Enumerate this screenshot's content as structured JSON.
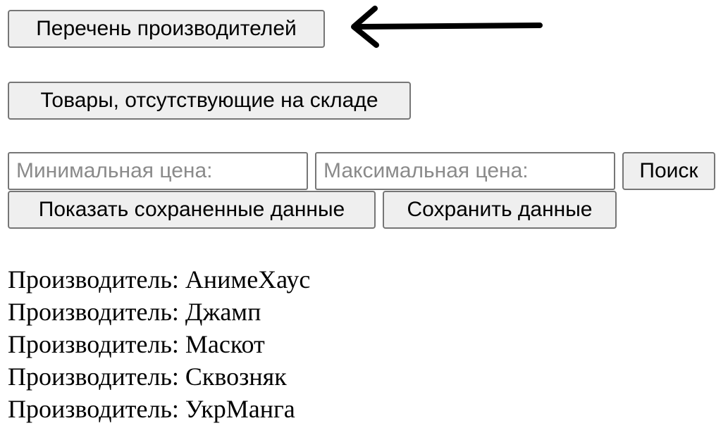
{
  "buttons": {
    "manufacturers": "Перечень производителей",
    "out_of_stock": "Товары, отсутствующие на складе",
    "search": "Поиск",
    "show_saved": "Показать сохраненные данные",
    "save": "Сохранить данные"
  },
  "filters": {
    "min_price": {
      "placeholder": "Минимальная цена:",
      "value": ""
    },
    "max_price": {
      "placeholder": "Максимальная цена:",
      "value": ""
    }
  },
  "annotation": {
    "icon": "left-arrow-icon",
    "color": "#000000"
  },
  "results": [
    {
      "label": "Производитель:",
      "name": "АнимеХаус"
    },
    {
      "label": "Производитель:",
      "name": "Джамп"
    },
    {
      "label": "Производитель:",
      "name": "Маскот"
    },
    {
      "label": "Производитель:",
      "name": "Сквозняк"
    },
    {
      "label": "Производитель:",
      "name": "УкрМанга"
    }
  ]
}
